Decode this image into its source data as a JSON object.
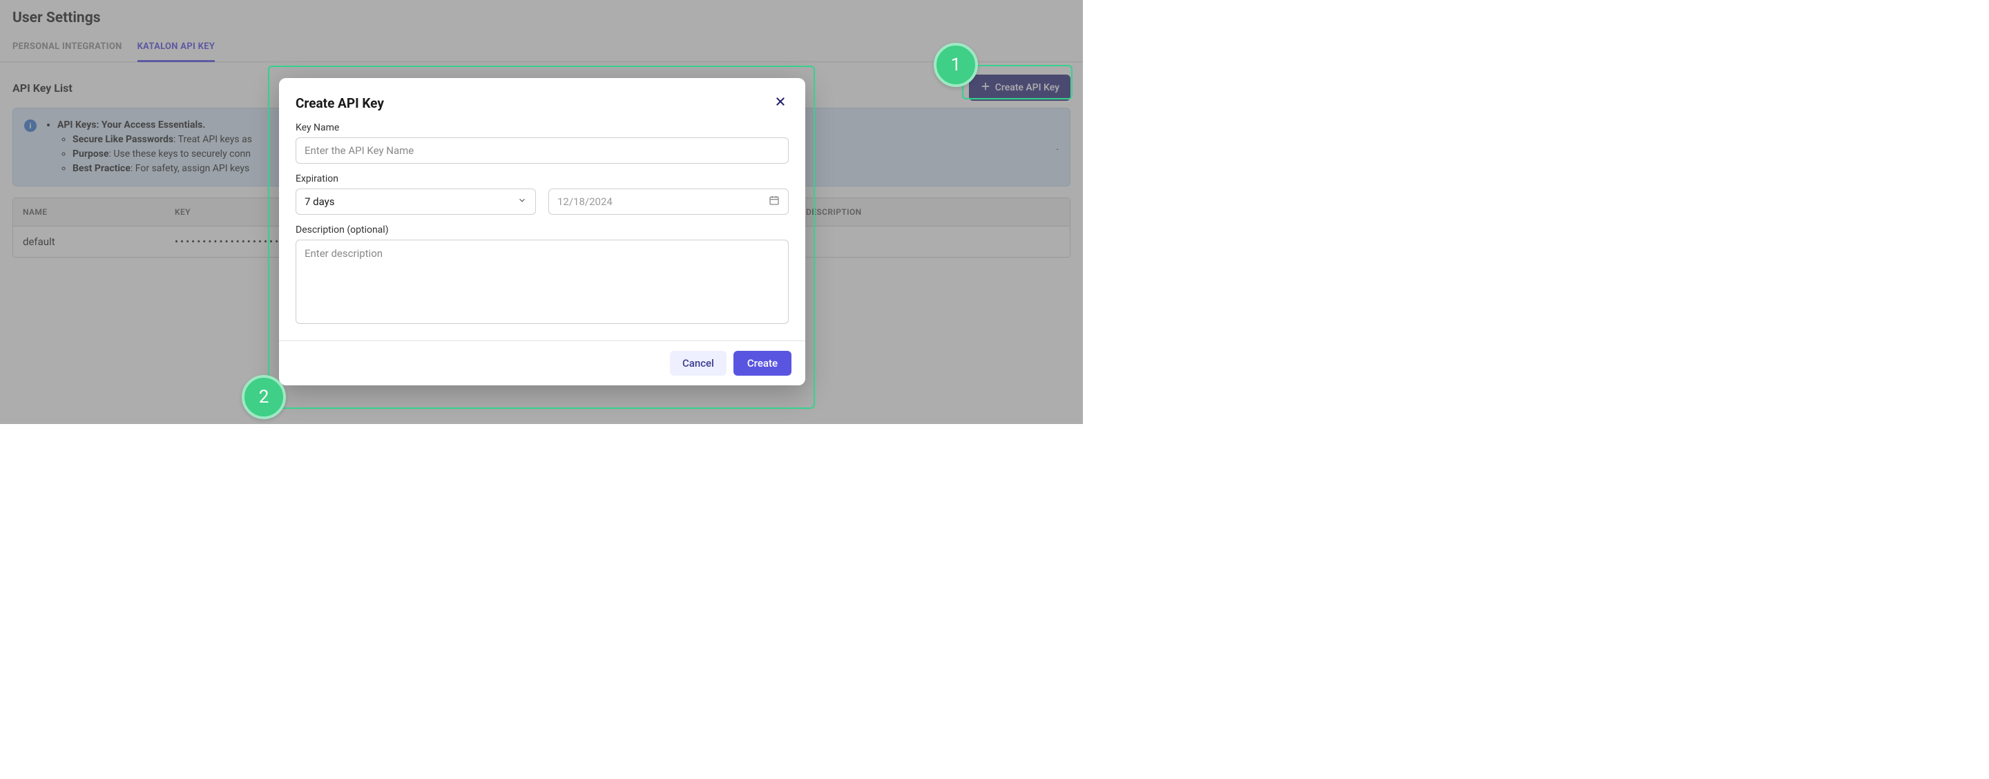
{
  "page_title": "User Settings",
  "tabs": {
    "personal_integration": "PERSONAL INTEGRATION",
    "katalon_api_key": "KATALON API KEY"
  },
  "section_title": "API Key List",
  "create_button": "Create API Key",
  "info": {
    "title": "API Keys: Your Access Essentials.",
    "bullets": {
      "secure_label": "Secure Like Passwords",
      "secure_text": ": Treat API keys as",
      "purpose_label": "Purpose",
      "purpose_text": ": Use these keys to securely conn",
      "best_label": "Best Practice",
      "best_text": ": For safety, assign API keys"
    },
    "trailing_dot": "."
  },
  "table": {
    "headers": {
      "name": "NAME",
      "key": "KEY",
      "description": "DESCRIPTION"
    },
    "rows": [
      {
        "name": "default",
        "key": "•••••••••••••••••••••"
      }
    ]
  },
  "modal": {
    "title": "Create API Key",
    "key_name_label": "Key Name",
    "key_name_placeholder": "Enter the API Key Name",
    "expiration_label": "Expiration",
    "expiration_value": "7 days",
    "expiration_date": "12/18/2024",
    "description_label": "Description (optional)",
    "description_placeholder": "Enter description",
    "cancel": "Cancel",
    "create": "Create"
  },
  "callouts": {
    "one": "1",
    "two": "2"
  }
}
